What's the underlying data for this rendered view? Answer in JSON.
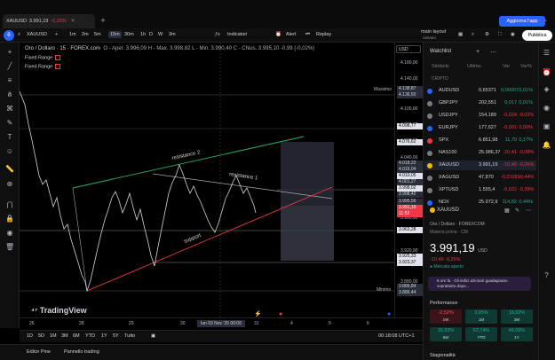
{
  "tab": {
    "symbol": "XAUUSD",
    "price": "3.991,19",
    "change": "-0,26%",
    "close_glyph": "✕"
  },
  "top": {
    "add_tab": "+",
    "upgrade": "Aggiorna l'app",
    "chevron": "⌄"
  },
  "toolbar": {
    "symbol": "XAUUSD",
    "add": "+",
    "intervals": [
      "1m",
      "2m",
      "5m",
      "15m",
      "30m",
      "1h",
      "D",
      "W",
      "3m"
    ],
    "active_interval": "15m",
    "indicators": "Indicatori",
    "alert": "Alert",
    "replay": "Replay",
    "layout": "main layout",
    "layout_sub": "Salvato",
    "publish": "Pubblica",
    "logo": "6"
  },
  "chart": {
    "title": "Oro / Dollaro · 15 · FOREX.com",
    "ohlc": "O - Aper. 3.996,09  H - Max. 3.998,82  L - Min. 3.990,40  C - Chius. 3.995,10  -0,99 (-0,02%)",
    "fixed_range": [
      "Fixed Range",
      "Fixed Range"
    ],
    "currency": "USD",
    "annotations": {
      "res2": "resistance 2",
      "res1": "resistance 1",
      "support": "support"
    },
    "price_labels": [
      "4.180,00",
      "4.140,00",
      "4.120,00",
      "4.100,00",
      "4.080,00",
      "4.060,00",
      "4.040,00",
      "4.020,00",
      "4.000,00",
      "3.960,00",
      "3.940,00",
      "3.920,00",
      "3.900,00",
      "3.880,00"
    ],
    "price_tags": [
      {
        "text": "4.138,87",
        "bg": "#2a2e39",
        "fg": "#d1d4dc"
      },
      {
        "text": "4.136,50",
        "bg": "#2a2e39",
        "fg": "#d1d4dc"
      },
      {
        "text": "4.098,77",
        "bg": "#e0e3eb",
        "fg": "#000000"
      },
      {
        "text": "4.076,62",
        "bg": "#e0e3eb",
        "fg": "#000000"
      },
      {
        "text": "4.018,22",
        "bg": "#2a2e39",
        "fg": "#d1d4dc"
      },
      {
        "text": "4.016,04",
        "bg": "#2a2e39",
        "fg": "#d1d4dc"
      },
      {
        "text": "4.010,05",
        "bg": "#e0e3eb",
        "fg": "#000000"
      },
      {
        "text": "4.001,27",
        "bg": "#2a2e39",
        "fg": "#d1d4dc"
      },
      {
        "text": "3.998,02",
        "bg": "#e0e3eb",
        "fg": "#000000"
      },
      {
        "text": "3.998,42",
        "bg": "#2a2e39",
        "fg": "#d1d4dc"
      },
      {
        "text": "3.995,56",
        "bg": "#2a2e39",
        "fg": "#d1d4dc"
      },
      {
        "text": "3.991,19",
        "bg": "#f23645",
        "fg": "#ffffff"
      },
      {
        "text": "11:52",
        "bg": "#f23645",
        "fg": "#ffffff"
      },
      {
        "text": "3.963,28",
        "bg": "#e0e3eb",
        "fg": "#000000"
      },
      {
        "text": "3.925,33",
        "bg": "#e0e3eb",
        "fg": "#000000"
      },
      {
        "text": "3.923,37",
        "bg": "#e0e3eb",
        "fg": "#000000"
      },
      {
        "text": "3.886,84",
        "bg": "#2a2e39",
        "fg": "#d1d4dc"
      },
      {
        "text": "3.886,44",
        "bg": "#2a2e39",
        "fg": "#d1d4dc"
      }
    ],
    "max_label": "Massimo",
    "min_label": "Minimo",
    "x_labels": [
      "26",
      "28",
      "29",
      "30",
      "31",
      "4",
      "5",
      "6",
      "7"
    ],
    "date_cursor": "lun 03 Nov '25  00:00",
    "watermark": "TradingView"
  },
  "timeframes": [
    "1D",
    "5D",
    "1M",
    "3M",
    "6M",
    "YTD",
    "1Y",
    "5Y",
    "Tutto"
  ],
  "clock": "00:18:08 UTC+1",
  "bottom_tabs": [
    "Editor Pine",
    "Pannello trading"
  ],
  "watchlist": {
    "title": "Watchlist",
    "headers": {
      "symbol": "Simbolo",
      "last": "Ultimo",
      "chg": "Var",
      "pct": "Var%"
    },
    "section": "CRIPTO",
    "rows": [
      {
        "sym": "AUDUSD",
        "last": "0,65371",
        "chg": "0,00007",
        "pct": "0,01%",
        "dir": "pos",
        "color": "#2962ff"
      },
      {
        "sym": "GBPJPY",
        "last": "202,551",
        "chg": "0,017",
        "pct": "0,01%",
        "dir": "pos",
        "color": "#787b86"
      },
      {
        "sym": "USDJPY",
        "last": "154,189",
        "chg": "-0,024",
        "pct": "-0,02%",
        "dir": "neg",
        "color": "#787b86"
      },
      {
        "sym": "EURJPY",
        "last": "177,627",
        "chg": "-0,001",
        "pct": "0,00%",
        "dir": "neg",
        "color": "#2962ff"
      },
      {
        "sym": "SPX",
        "last": "6.851,98",
        "chg": "11,79",
        "pct": "0,17%",
        "dir": "pos",
        "color": "#f23645"
      },
      {
        "sym": "NAS100",
        "last": "25.986,37",
        "chg": "-20,41",
        "pct": "-0,08%",
        "dir": "neg",
        "color": "#787b86"
      },
      {
        "sym": "XAUUSD",
        "last": "3.991,19",
        "chg": "-10,49",
        "pct": "-0,26%",
        "dir": "neg",
        "color": "#f0b90b"
      },
      {
        "sym": "XAGUSD",
        "last": "47,870",
        "chg": "-0,21081",
        "pct": "-0,44%",
        "dir": "neg",
        "color": "#787b86"
      },
      {
        "sym": "XPTUSD",
        "last": "1.555,4",
        "chg": "-6,022",
        "pct": "-0,39%",
        "dir": "neg",
        "color": "#787b86"
      },
      {
        "sym": "NDX",
        "last": "25.972,9",
        "chg": "114,82",
        "pct": "0,44%",
        "dir": "pos",
        "color": "#2962ff"
      }
    ]
  },
  "detail": {
    "symbol": "XAUUSD",
    "sub": "Oro / Dollaro · FOREXCOM",
    "sub2": "Materia prima · CM",
    "price": "3.991,19",
    "currency": "USD",
    "change": "-10,49  -0,26%",
    "status": "● Mercato aperto",
    "news": "6 ore fa · Gli indici azionari guadagnano soprattutto dopo...",
    "perf_title": "Performance",
    "perf": [
      {
        "val": "-2,52%",
        "lbl": "1W",
        "dir": "r"
      },
      {
        "val": "3,95%",
        "lbl": "1M",
        "dir": "g"
      },
      {
        "val": "18,92%",
        "lbl": "3M",
        "dir": "g"
      },
      {
        "val": "16,93%",
        "lbl": "6M",
        "dir": "g"
      },
      {
        "val": "52,74%",
        "lbl": "YTD",
        "dir": "g"
      },
      {
        "val": "46,09%",
        "lbl": "1Y",
        "dir": "g"
      }
    ],
    "seasonality": "Stagionalità"
  }
}
